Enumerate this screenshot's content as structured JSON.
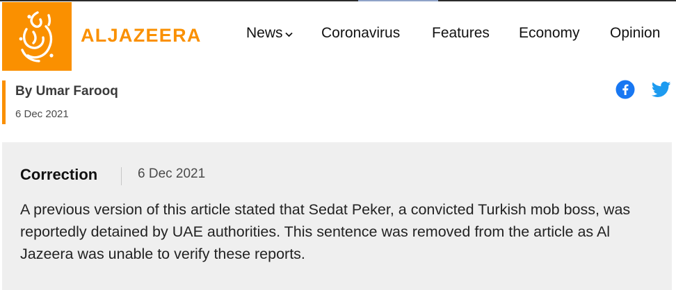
{
  "colors": {
    "brand_orange": "#fa9000",
    "facebook_blue": "#1877f2",
    "twitter_blue": "#1d9bf0",
    "correction_bg": "#efefef"
  },
  "header": {
    "logo_icon": "aljazeera-calligraphy-logo",
    "brand_name": "ALJAZEERA",
    "nav": [
      {
        "label": "News",
        "has_dropdown": true
      },
      {
        "label": "Coronavirus"
      },
      {
        "label": "Features"
      },
      {
        "label": "Economy"
      },
      {
        "label": "Opinion"
      }
    ],
    "dropdown_icon": "chevron-down-icon"
  },
  "byline": {
    "author": "By Umar Farooq",
    "date": "6 Dec 2021"
  },
  "share": {
    "icons": [
      "facebook-icon",
      "twitter-icon"
    ]
  },
  "correction": {
    "title": "Correction",
    "date": "6 Dec 2021",
    "text": "A previous version of this article stated that Sedat Peker, a convicted Turkish mob boss, was reportedly detained by UAE authorities. This sentence was removed from the article as Al Jazeera was unable to verify these reports."
  }
}
